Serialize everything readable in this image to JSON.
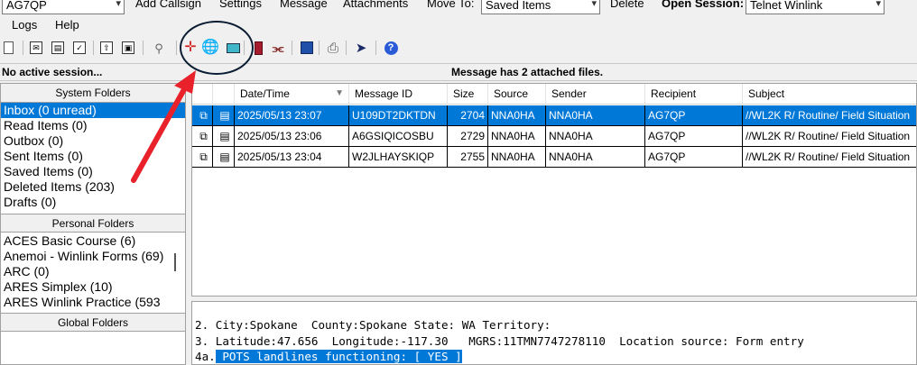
{
  "topbar": {
    "callsign_value": "AG7QP",
    "menu": [
      "Add Callsign",
      "Settings",
      "Message",
      "Attachments"
    ],
    "move_to_label": "Move To:",
    "move_to_value": "Saved Items",
    "delete_label": "Delete",
    "open_session_label": "Open Session:",
    "open_session_value": "Telnet Winlink"
  },
  "menurow2": {
    "logs": "Logs",
    "help": "Help"
  },
  "toolbar": {
    "icons": [
      "new-message-icon",
      "inbox-icon",
      "read-icon",
      "outbox-icon",
      "sent-icon",
      "saved-icon",
      "search-icon",
      "position-icon",
      "globe-icon",
      "catalog-icon",
      "book-icon",
      "antenna-icon",
      "save-icon",
      "print-icon",
      "forward-icon",
      "help-icon"
    ]
  },
  "status": {
    "left": "No active session...",
    "center": "Message has 2 attached files."
  },
  "system_folders": {
    "header": "System Folders",
    "items": [
      "Inbox (0 unread)",
      "Read Items  (0)",
      "Outbox  (0)",
      "Sent Items  (0)",
      "Saved Items  (0)",
      "Deleted Items  (203)",
      "Drafts  (0)"
    ]
  },
  "personal_folders": {
    "header": "Personal Folders",
    "items": [
      "ACES Basic Course  (6)",
      "Anemoi - Winlink Forms  (69)",
      "ARC  (0)",
      "ARES Simplex  (10)",
      "ARES Winlink Practice  (593"
    ]
  },
  "global_folders": {
    "header": "Global Folders"
  },
  "messages": {
    "columns": [
      "Date/Time",
      "Message ID",
      "Size",
      "Source",
      "Sender",
      "Recipient",
      "Subject"
    ],
    "rows": [
      {
        "datetime": "2025/05/13 23:07",
        "id": "U109DT2DKTDN",
        "size": "2704",
        "source": "NNA0HA",
        "sender": "NNA0HA",
        "recipient": "AG7QP",
        "subject": "//WL2K R/ Routine/ Field Situation"
      },
      {
        "datetime": "2025/05/13 23:06",
        "id": "A6GSIQICOSBU",
        "size": "2729",
        "source": "NNA0HA",
        "sender": "NNA0HA",
        "recipient": "AG7QP",
        "subject": "//WL2K R/ Routine/ Field Situation"
      },
      {
        "datetime": "2025/05/13 23:04",
        "id": "W2JLHAYSKIQP",
        "size": "2755",
        "source": "NNA0HA",
        "sender": "NNA0HA",
        "recipient": "AG7QP",
        "subject": "//WL2K R/ Routine/ Field Situation"
      }
    ]
  },
  "preview": {
    "line1": "2. City:Spokane  County:Spokane State: WA Territory:",
    "line2": "3. Latitude:47.656  Longitude:-117.30   MGRS:11TMN7747278110  Location source: Form entry",
    "line3_prefix": "4a.",
    "line3_highlight": " POTS landlines functioning: [ YES ]"
  },
  "colors": {
    "selection": "#0078d7",
    "arrow": "#e8212a",
    "circle": "#0b1d33"
  }
}
